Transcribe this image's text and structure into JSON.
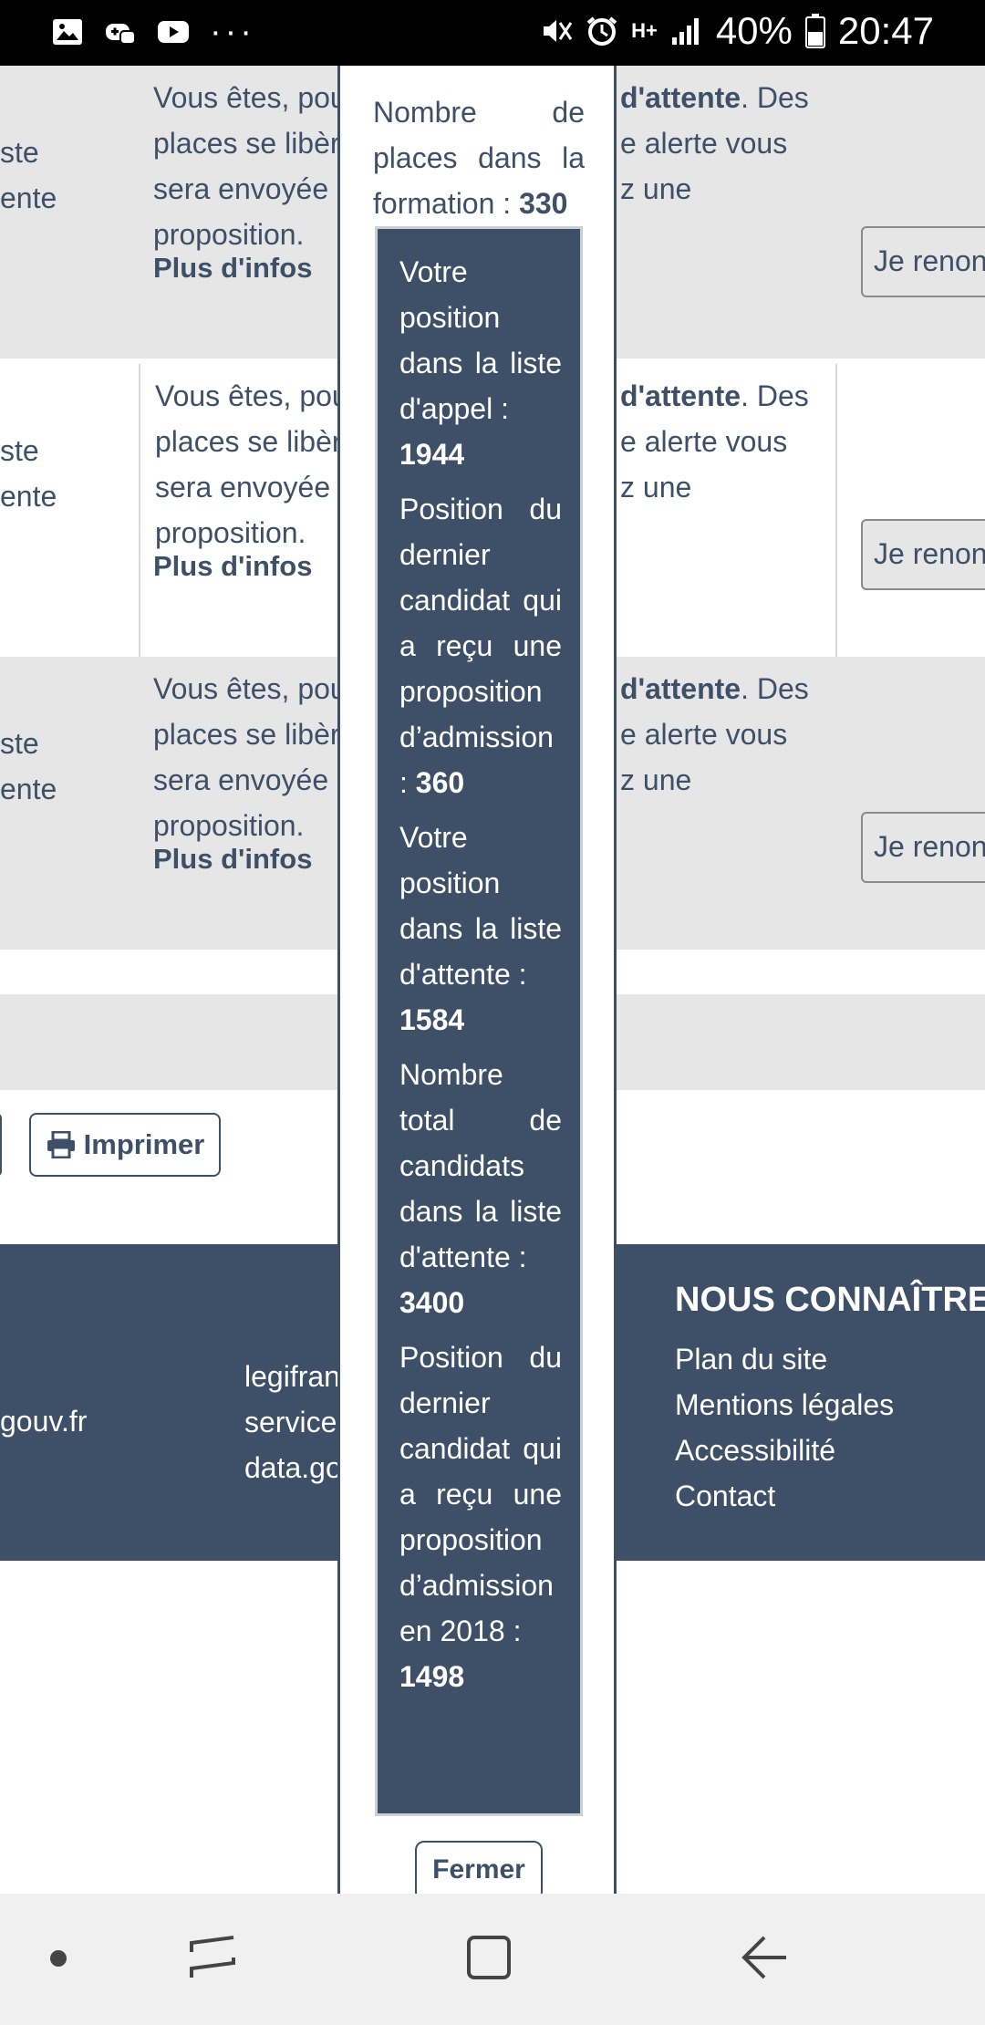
{
  "status_bar": {
    "battery": "40%",
    "time": "20:47",
    "network": "H+",
    "icons": [
      "gallery-icon",
      "game-icon",
      "youtube-icon",
      "more-icon",
      "mute-icon",
      "alarm-icon",
      "signal-icon",
      "battery-icon"
    ]
  },
  "rows": [
    {
      "left_top": "ste",
      "left_bottom": "ente",
      "line1": "Vous êtes, pou",
      "line2": "places se libèr",
      "line3": "sera envoyée",
      "line4": "proposition.",
      "right_bold": "d'attente",
      "right_line1": ". Des",
      "right_line2": "e alerte vous",
      "right_line3": "z une",
      "more": "Plus d'infos",
      "button": "Je renon"
    },
    {
      "left_top": "ste",
      "left_bottom": "ente",
      "line1": "Vous êtes, pou",
      "line2": "places se libèr",
      "line3": "sera envoyée",
      "line4": "proposition.",
      "right_bold": "d'attente",
      "right_line1": ". Des",
      "right_line2": "e alerte vous",
      "right_line3": "z une",
      "more": "Plus d'infos",
      "button": "Je renon"
    },
    {
      "left_top": "ste",
      "left_bottom": "ente",
      "line1": "Vous êtes, pou",
      "line2": "places se libèr",
      "line3": "sera envoyée",
      "line4": "proposition.",
      "right_bold": "d'attente",
      "right_line1": ". Des",
      "right_line2": "e alerte vous",
      "right_line3": "z une",
      "more": "Plus d'infos",
      "button": "Je renon"
    }
  ],
  "print_button": "Imprimer",
  "footer": {
    "left": "gouv.fr",
    "mid": [
      "legifran",
      "service",
      "data.go"
    ],
    "right_title": "NOUS CONNAÎTRE",
    "links": [
      "Plan du site",
      "Mentions légales",
      "Accessibilité",
      "Contact"
    ]
  },
  "popup": {
    "places_label": "Nombre de places dans la formation :",
    "places_value": "330",
    "items": [
      {
        "label": "Votre position dans la liste d'appel :",
        "value": "1944"
      },
      {
        "label": "Position du dernier candidat qui a reçu une proposition d’admission :",
        "value": "360"
      },
      {
        "label": "Votre position dans la liste d'attente :",
        "value": "1584"
      },
      {
        "label": "Nombre total de candidats dans la liste d'attente :",
        "value": "3400"
      },
      {
        "label": "Position du dernier candidat qui a reçu une proposition d’admission en 2018 :",
        "value": "1498"
      }
    ],
    "close_button": "Fermer"
  }
}
